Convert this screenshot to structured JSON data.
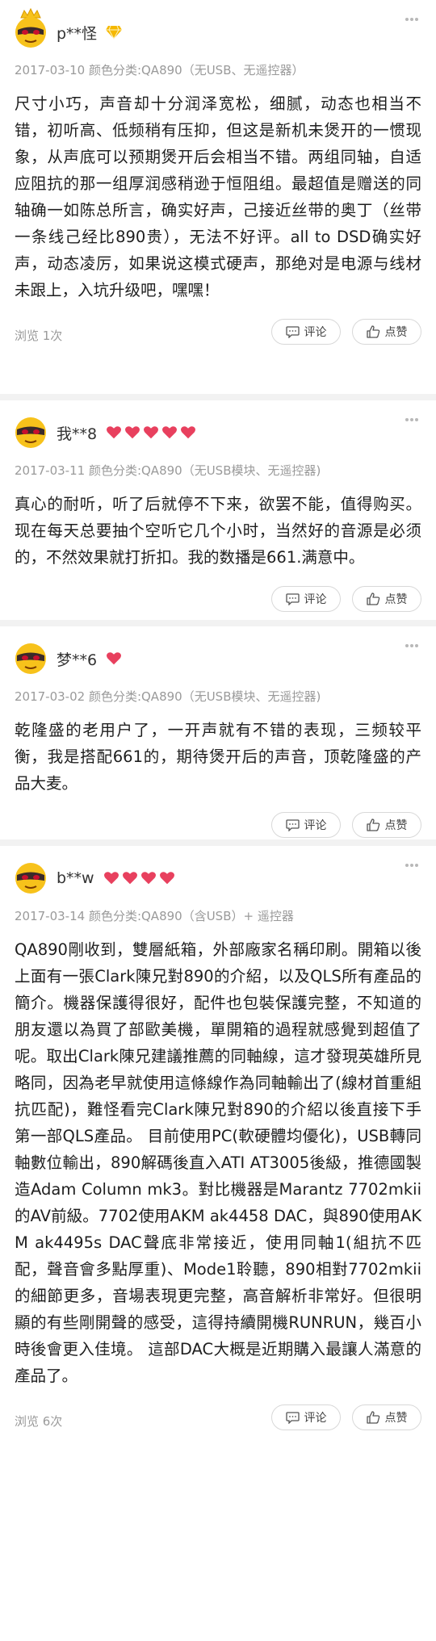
{
  "reviews": [
    {
      "username": "p**怪",
      "meta": "2017-03-10 颜色分类:QA890（无USB、无遥控器）",
      "content": "尺寸小巧，声音却十分润泽宽松，细腻，动态也相当不错，初听高、低频稍有压抑，但这是新机未煲开的一惯现象，从声底可以预期煲开后会相当不错。两组同轴，自适应阻抗的那一组厚润感稍逊于恒阻组。最超值是赠送的同轴确一如陈总所言，确实好声，己接近丝带的奥丁（丝带一条线己经比890贵），无法不好评。all to DSD确实好声，动态凌厉，如果说这模式硬声，那绝对是电源与线材未跟上，入坑升级吧，嘿嘿！",
      "views": "浏览 1次",
      "comment_label": "评论",
      "like_label": "点赞",
      "badge": "diamond-icon"
    },
    {
      "username": "我**8",
      "meta": "2017-03-11 颜色分类:QA890（无USB模块、无遥控器)",
      "content": "真心的耐听，听了后就停不下来，欲罢不能，值得购买。现在每天总要抽个空听它几个小时，当然好的音源是必须的，不然效果就打折扣。我的数播是661.满意中。",
      "views": "",
      "comment_label": "评论",
      "like_label": "点赞",
      "hearts": 5
    },
    {
      "username": "梦**6",
      "meta": "2017-03-02 颜色分类:QA890（无USB模块、无遥控器)",
      "content": "乾隆盛的老用户了，一开声就有不错的表现，三频较平衡，我是搭配661的，期待煲开后的声音，顶乾隆盛的产品大麦。",
      "views": "",
      "comment_label": "评论",
      "like_label": "点赞",
      "hearts": 1
    },
    {
      "username": "b**w",
      "meta": "2017-03-14 颜色分类:QA890（含USB）+ 遥控器",
      "content": "QA890剛收到，雙層紙箱，外部廠家名稱印刷。開箱以後上面有一張Clark陳兄對890的介紹，以及QLS所有產品的簡介。機器保護得很好，配件也包裝保護完整，不知道的朋友還以為買了部歐美機，單開箱的過程就感覺到超值了呢。取出Clark陳兄建議推薦的同軸線，這才發現英雄所見略同，因為老早就使用這條線作為同軸輸出了(線材首重組抗匹配)，難怪看完Clark陳兄對890的介紹以後直接下手第一部QLS產品。 目前使用PC(軟硬體均優化)，USB轉同軸數位輸出，890解碼後直入ATI AT3005後級，推德國製造Adam Column mk3。對比機器是Marantz 7702mkii的AV前級。7702使用AKM ak4458 DAC，與890使用AKM ak4495s DAC聲底非常接近，使用同軸1(組抗不匹配，聲音會多點厚重)、Mode1聆聽，890相對7702mkii的細節更多，音場表現更完整，高音解析非常好。但很明顯的有些剛開聲的感受，這得持續開機RUNRUN，幾百小時後會更入佳境。 這部DAC大概是近期購入最讓人滿意的產品了。",
      "views": "浏览 6次",
      "comment_label": "评论",
      "like_label": "点赞",
      "hearts": 4
    }
  ],
  "icons": {
    "more": "more-dots-icon",
    "comment": "comment-icon",
    "like": "thumbs-up-icon",
    "avatar": "masked-face-avatar",
    "crown": "crown-icon",
    "heart": "heart-icon"
  },
  "colors": {
    "heart": "#e8405e",
    "diamond": "#f5b800",
    "avatar_face": "#f7c21b",
    "meta_text": "#9a9a9a"
  }
}
